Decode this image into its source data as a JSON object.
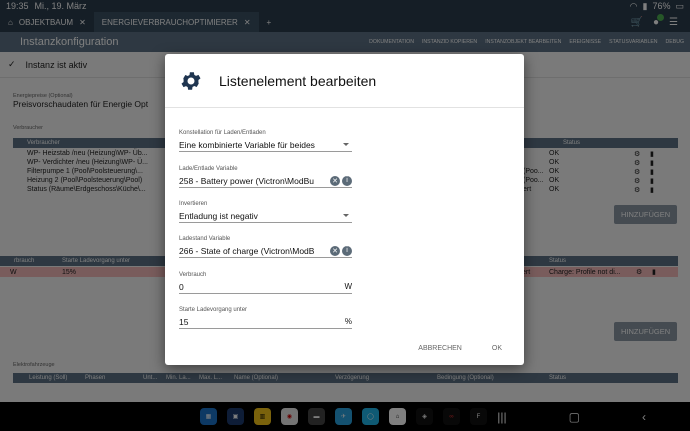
{
  "status_bar": {
    "time": "19:35",
    "date": "Mi., 19. März",
    "battery": "76%"
  },
  "tabs": [
    {
      "label": "OBJEKTBAUM"
    },
    {
      "label": "ENERGIEVERBRAUCHOPTIMIERER"
    }
  ],
  "appbar": {
    "title": "Instanzkonfiguration",
    "tools": [
      "DOKUMENTATION",
      "INSTANZID KOPIEREN",
      "INSTANZOBJEKT BEARBEITEN",
      "EREIGNISSE",
      "STATUSVARIABLEN",
      "DEBUG"
    ]
  },
  "page": {
    "active_text": "Instanz ist aktiv",
    "energy_label": "Energiepreise (Optional)",
    "energy_value": "Preisvorschaudaten für Energie Opt",
    "consumers_label": "Verbraucher",
    "consumers_header": {
      "col1": "Verbraucher",
      "status": "Status"
    },
    "consumers": [
      {
        "name": "WP- Heizstab /neu (Heizung\\WP- Üb...",
        "status": "OK"
      },
      {
        "name": "WP- Verdichter /neu (Heizung\\WP- Ü...",
        "status": "OK"
      },
      {
        "name": "Filterpumpe 1 (Pool\\Poolsteuerung\\...",
        "mid": "(Poo...",
        "status": "OK"
      },
      {
        "name": "Heizung 2 (Pool\\Poolsteuerung\\Pool)",
        "mid": "(Poo...",
        "status": "OK"
      },
      {
        "name": "Status (Räume\\Erdgeschoss\\Küche\\...",
        "mid": "ert",
        "status": "OK"
      }
    ],
    "add_button": "HINZUFÜGEN",
    "battery_header": {
      "col0": "rbrauch",
      "col1": "Starte Ladevorgang unter",
      "status": "Status"
    },
    "battery_row": {
      "col0": "W",
      "col1": "15%",
      "mid": "ert",
      "status": "Charge: Profile not di..."
    },
    "add_button2": "HINZUFÜGEN",
    "ev_label": "Elektrofahrzeuge",
    "ev_header": [
      "Leistung (Soll)",
      "Phasen",
      "Unt...",
      "Min. La...",
      "Max. L...",
      "Name (Optional)",
      "Verzögerung",
      "Bedingung (Optional)",
      "Status"
    ]
  },
  "dialog": {
    "title": "Listenelement bearbeiten",
    "fields": {
      "constellation": {
        "label": "Konstellation für Laden/Entladen",
        "value": "Eine kombinierte Variable für beides"
      },
      "charge_var": {
        "label": "Lade/Entlade Variable",
        "value": "258 - Battery power (Victron\\ModBu"
      },
      "invert": {
        "label": "Invertieren",
        "value": "Entladung ist negativ"
      },
      "soc_var": {
        "label": "Ladestand Variable",
        "value": "266 - State of charge (Victron\\ModB"
      },
      "consumption": {
        "label": "Verbrauch",
        "value": "0",
        "unit": "W"
      },
      "start_below": {
        "label": "Starte Ladevorgang unter",
        "value": "15",
        "unit": "%"
      }
    },
    "cancel": "ABBRECHEN",
    "ok": "OK"
  },
  "colors": {
    "header_dark": "#2b3d4d",
    "header": "#5c7184",
    "error_row": "#f2b8b8",
    "notify_green": "#4caf50"
  }
}
